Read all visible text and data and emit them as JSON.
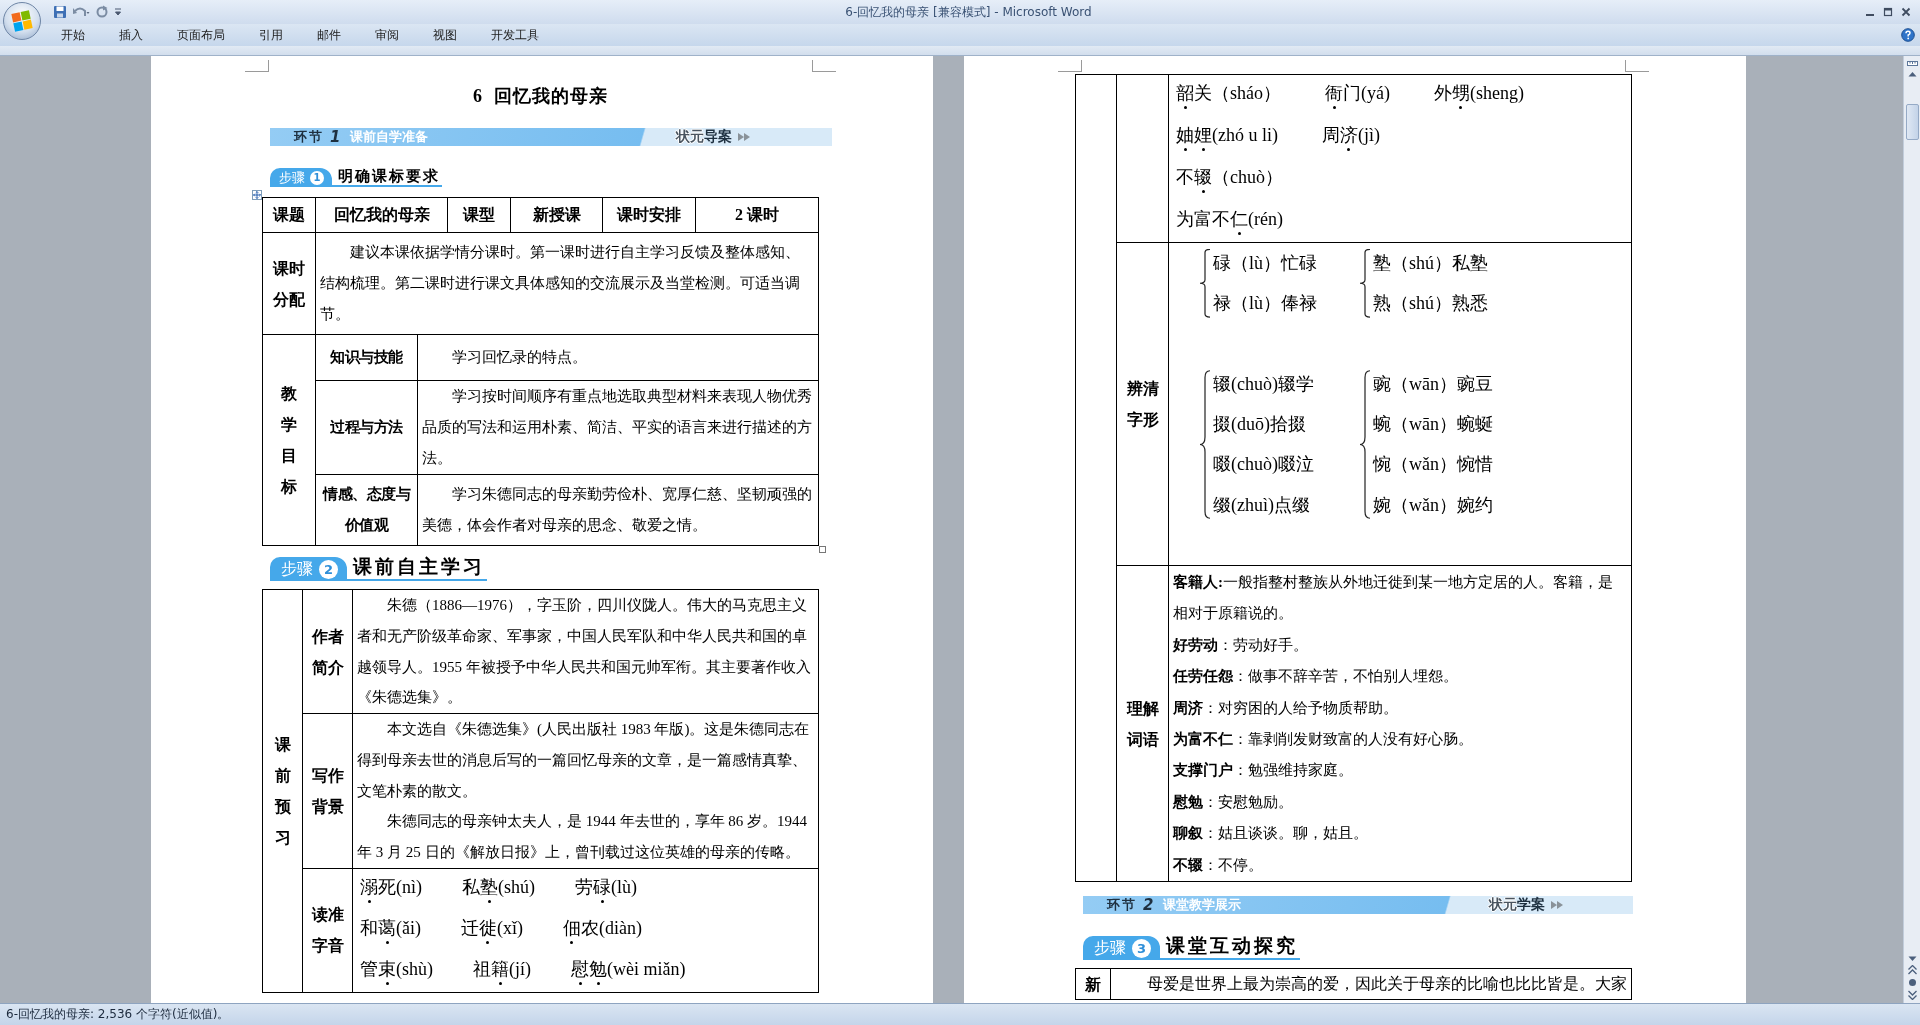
{
  "window": {
    "title": "6-回忆我的母亲 [兼容模式] - Microsoft Word"
  },
  "ribbon": {
    "tabs": [
      {
        "label": "开始",
        "selected": false
      },
      {
        "label": "插入",
        "selected": false
      },
      {
        "label": "页面布局",
        "selected": false
      },
      {
        "label": "引用",
        "selected": false
      },
      {
        "label": "邮件",
        "selected": false
      },
      {
        "label": "审阅",
        "selected": false
      },
      {
        "label": "视图",
        "selected": false
      },
      {
        "label": "开发工具",
        "selected": false
      }
    ]
  },
  "left_page": {
    "title": "6  回忆我的母亲",
    "banner": {
      "label": "环节",
      "number": "1",
      "title": "课前自学准备",
      "brand": "状元**导案**"
    },
    "step1": {
      "label": "步骤",
      "number": "1",
      "heading": "明确课标要求"
    },
    "plan_table": {
      "header": [
        "课题",
        "回忆我的母亲",
        "课型",
        "新授课",
        "课时安排",
        "2 课时"
      ],
      "allocation": {
        "label": "课时分配",
        "text": "建议本课依据学情分课时。第一课时进行自主学习反馈及整体感知、结构梳理。第二课时进行课文具体感知的交流展示及当堂检测。可适当调节。"
      },
      "goals": {
        "label": "教学目标",
        "rows": [
          {
            "label": "知识与技能",
            "text": "学习回忆录的特点。"
          },
          {
            "label": "过程与方法",
            "text": "学习按时间顺序有重点地选取典型材料来表现人物优秀品质的写法和运用朴素、简洁、平实的语言来进行描述的方法。"
          },
          {
            "label": "情感、态度与价值观",
            "text": "学习朱德同志的母亲勤劳俭朴、宽厚仁慈、坚韧顽强的美德，体会作者对母亲的思念、敬爱之情。"
          }
        ]
      }
    },
    "step2": {
      "label": "步骤",
      "number": "2",
      "heading": "课前自主学习"
    },
    "preview_table": {
      "label": "课前预习",
      "rows": [
        {
          "kind": "text",
          "label": "作者简介",
          "paragraphs": [
            "朱德（1886—1976），字玉阶，四川仪陇人。伟大的马克思主义者和无产阶级革命家、军事家，中国人民军队和中华人民共和国的卓越领导人。1955 年被授予中华人民共和国元帅军衔。其主要著作收入《朱德选集》。"
          ]
        },
        {
          "kind": "text",
          "label": "写作背景",
          "paragraphs": [
            "本文选自《朱德选集》(人民出版社 1983 年版)。这是朱德同志在得到母亲去世的消息后写的一篇回忆母亲的文章，是一篇感情真挚、文笔朴素的散文。",
            "朱德同志的母亲钟太夫人，是 1944 年去世的，享年 86 岁。1944 年 3 月 25 日的《解放日报》上，曾刊载过这位英雄的母亲的传略。"
          ]
        },
        {
          "kind": "pinyin",
          "label": "读准字音",
          "lines": [
            [
              {
                "chars": [
                  {
                    "text": "溺",
                    "dotted": true
                  },
                  {
                    "text": "死",
                    "dotted": false
                  }
                ],
                "reading": "(nì)"
              },
              {
                "chars": [
                  {
                    "text": "私",
                    "dotted": false
                  },
                  {
                    "text": "塾",
                    "dotted": true
                  }
                ],
                "reading": "(shú)"
              },
              {
                "chars": [
                  {
                    "text": "劳",
                    "dotted": false
                  },
                  {
                    "text": "碌",
                    "dotted": true
                  }
                ],
                "reading": "(lù)"
              }
            ],
            [
              {
                "chars": [
                  {
                    "text": "和",
                    "dotted": false
                  },
                  {
                    "text": "蔼",
                    "dotted": true
                  }
                ],
                "reading": "(ǎi)"
              },
              {
                "chars": [
                  {
                    "text": "迁",
                    "dotted": false
                  },
                  {
                    "text": "徙",
                    "dotted": true
                  }
                ],
                "reading": "(xǐ)"
              },
              {
                "chars": [
                  {
                    "text": "佃",
                    "dotted": true
                  },
                  {
                    "text": "农",
                    "dotted": false
                  }
                ],
                "reading": "(diàn)"
              }
            ],
            [
              {
                "chars": [
                  {
                    "text": "管",
                    "dotted": false
                  },
                  {
                    "text": "束",
                    "dotted": true
                  }
                ],
                "reading": "(shù)"
              },
              {
                "chars": [
                  {
                    "text": "祖",
                    "dotted": false
                  },
                  {
                    "text": "籍",
                    "dotted": true
                  }
                ],
                "reading": "(jí)"
              },
              {
                "chars": [
                  {
                    "text": "慰",
                    "dotted": true
                  },
                  {
                    "text": "勉",
                    "dotted": true
                  }
                ],
                "reading": "(wèi miǎn)"
              }
            ]
          ]
        }
      ]
    }
  },
  "right_page": {
    "preview_table_continued": {
      "rows": [
        {
          "kind": "pinyin",
          "lines": [
            [
              {
                "chars": [
                  {
                    "text": "韶",
                    "dotted": true
                  },
                  {
                    "text": "关",
                    "dotted": false
                  }
                ],
                "reading": "（sháo）"
              },
              {
                "chars": [
                  {
                    "text": "衙",
                    "dotted": true
                  },
                  {
                    "text": "门",
                    "dotted": false
                  }
                ],
                "reading": "(yá)"
              },
              {
                "chars": [
                  {
                    "text": "外",
                    "dotted": false
                  },
                  {
                    "text": "甥",
                    "dotted": true
                  }
                ],
                "reading": "(sheng)"
              }
            ],
            [
              {
                "chars": [
                  {
                    "text": "妯",
                    "dotted": true
                  },
                  {
                    "text": "娌",
                    "dotted": true
                  }
                ],
                "reading": "(zhó u li)"
              },
              {
                "chars": [
                  {
                    "text": "周",
                    "dotted": false
                  },
                  {
                    "text": "济",
                    "dotted": true
                  }
                ],
                "reading": "(jì)"
              }
            ],
            [
              {
                "chars": [
                  {
                    "text": "不",
                    "dotted": false
                  },
                  {
                    "text": "辍",
                    "dotted": true
                  }
                ],
                "reading": "（chuò）"
              }
            ],
            [
              {
                "chars": [
                  {
                    "text": "为",
                    "dotted": false
                  },
                  {
                    "text": "富",
                    "dotted": false
                  },
                  {
                    "text": "不",
                    "dotted": false
                  },
                  {
                    "text": "仁",
                    "dotted": true
                  }
                ],
                "reading": "(rén)"
              }
            ]
          ]
        },
        {
          "kind": "braces",
          "label": "辨清字形",
          "groups": [
            {
              "columns": [
                {
                  "entries": [
                    "碌（lù）忙碌",
                    "禄（lù）俸禄"
                  ]
                },
                {
                  "entries": [
                    "塾（shú）私塾",
                    "熟（shú）熟悉"
                  ]
                }
              ]
            },
            {
              "columns": [
                {
                  "entries": [
                    "辍(chuò)辍学",
                    "掇(duō)拾掇",
                    "啜(chuò)啜泣",
                    "缀(zhuì)点缀"
                  ]
                },
                {
                  "entries": [
                    "豌（wān）豌豆",
                    "蜿（wān）蜿蜒",
                    "惋（wǎn）惋惜",
                    "婉（wǎn）婉约"
                  ]
                }
              ]
            }
          ]
        },
        {
          "kind": "glossary",
          "label": "理解词语",
          "entries": [
            "**客籍人:**一般指整村整族从外地迁徙到某一地方定居的人。客籍，是相对于原籍说的。",
            "**好劳动**：劳动好手。",
            "**任劳任怨**：做事不辞辛苦，不怕别人埋怨。",
            "**周济**：对穷困的人给予物质帮助。",
            "**为富不仁**：靠剥削发财致富的人没有好心肠。",
            "**支撑门户**：勉强维持家庭。",
            "**慰勉**：安慰勉励。",
            "**聊叙**：姑且谈谈。聊，姑且。",
            "**不辍**：不停。"
          ]
        }
      ]
    },
    "banner": {
      "label": "环节",
      "number": "2",
      "title": "课堂教学展示",
      "brand": "状元**学案**"
    },
    "step3": {
      "label": "步骤",
      "number": "3",
      "heading": "课堂互动探究"
    },
    "explore_table": {
      "label": "新",
      "text": "母爱是世界上最为崇高的爱，因此关于母亲的比喻也比比皆是。大家"
    }
  },
  "status_bar": {
    "text": "6-回忆我的母亲: 2,536 个字符(近似值)。"
  }
}
